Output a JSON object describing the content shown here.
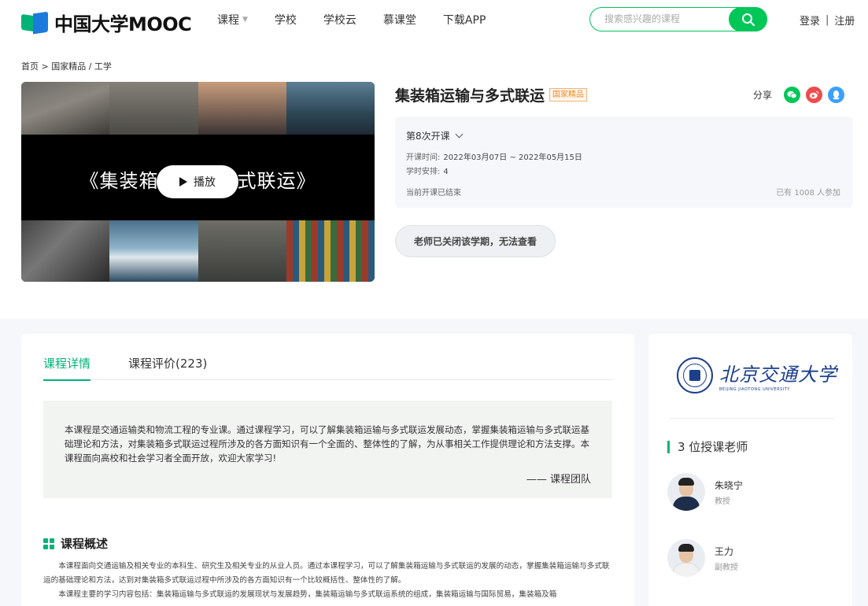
{
  "header": {
    "logo_text": "中国大学MOOC",
    "nav": [
      {
        "label": "课程",
        "has_caret": true
      },
      {
        "label": "学校"
      },
      {
        "label": "学校云"
      },
      {
        "label": "慕课堂"
      },
      {
        "label": "下载APP"
      }
    ],
    "search_placeholder": "搜索感兴趣的课程",
    "login": "登录",
    "separator": "|",
    "register": "注册"
  },
  "breadcrumb": "首页 > 国家精品 / 工学",
  "video": {
    "title": "《集装箱运输与多式联运》",
    "play_label": "播放"
  },
  "course": {
    "title": "集装箱运输与多式联运",
    "badge": "国家精品",
    "share_label": "分享",
    "term": "第8次开课",
    "time_label": "开课时间:",
    "time_value": "2022年03月07日 ~ 2022年05月15日",
    "schedule_label": "学时安排:",
    "schedule_value": "4",
    "status": "当前开课已结束",
    "enrolled": "已有 1008 人参加",
    "closed_button": "老师已关闭该学期，无法查看"
  },
  "tabs": [
    {
      "label": "课程详情",
      "active": true
    },
    {
      "label": "课程评价(223)",
      "active": false
    }
  ],
  "intro": {
    "text": "本课程是交通运输类和物流工程的专业课。通过课程学习，可以了解集装箱运输与多式联运发展动态，掌握集装箱运输与多式联运基础理论和方法，对集装箱多式联运过程所涉及的各方面知识有一个全面的、整体性的了解，为从事相关工作提供理论和方法支撑。本课程面向高校和社会学习者全面开放，欢迎大家学习!",
    "sign": "—— 课程团队"
  },
  "overview": {
    "heading": "课程概述",
    "p1": "本课程面向交通运输及相关专业的本科生、研究生及相关专业的从业人员。通过本课程学习，可以了解集装箱运输与多式联运的发展的动态，掌握集装箱运输与多式联运的基础理论和方法，达到对集装箱多式联运过程中所涉及的各方面知识有一个比较概括性、整体性的了解。",
    "p2": "本课程主要的学习内容包括：集装箱运输与多式联运的发展现状与发展趋势，集装箱运输与多式联运系统的组成，集装箱运输与国际贸易，集装箱及箱"
  },
  "sidebar": {
    "school_cn": "北京交通大学",
    "school_en": "BEIJING JIAOTONG UNIVERSITY",
    "teachers_heading": "3 位授课老师",
    "teachers": [
      {
        "name": "朱晓宁",
        "title": "教授"
      },
      {
        "name": "王力",
        "title": "副教授"
      }
    ]
  },
  "colors": {
    "accent": "#00b377",
    "search_green": "#00c758",
    "badge_orange": "#e88b2a",
    "school_blue": "#1c3f8a"
  },
  "icons": [
    "search-icon",
    "wechat-icon",
    "weibo-icon",
    "qq-icon",
    "play-icon",
    "chevron-down-icon",
    "grid-icon"
  ]
}
